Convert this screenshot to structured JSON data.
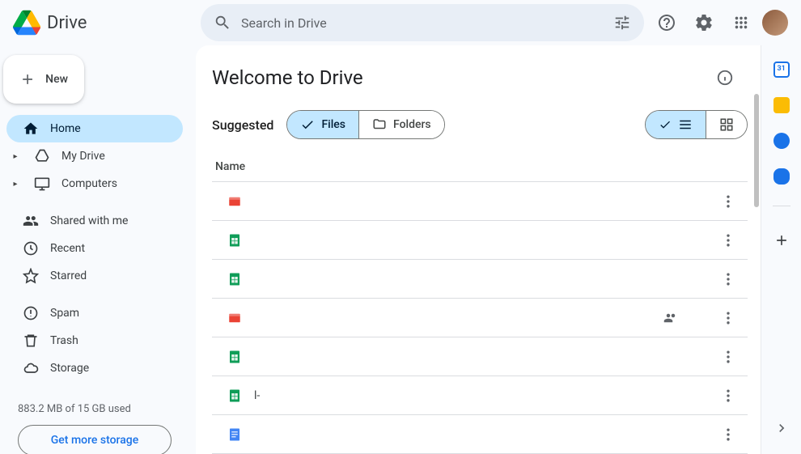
{
  "app_name": "Drive",
  "search": {
    "placeholder": "Search in Drive"
  },
  "new_button_label": "New",
  "nav": {
    "home": "Home",
    "my_drive": "My Drive",
    "computers": "Computers",
    "shared": "Shared with me",
    "recent": "Recent",
    "starred": "Starred",
    "spam": "Spam",
    "trash": "Trash",
    "storage": "Storage"
  },
  "storage_text": "883.2 MB of 15 GB used",
  "get_storage_label": "Get more storage",
  "main": {
    "title": "Welcome to Drive",
    "suggested": "Suggested",
    "files_label": "Files",
    "folders_label": "Folders",
    "column_name": "Name"
  },
  "files": [
    {
      "type": "video",
      "name": "",
      "shared": false
    },
    {
      "type": "sheet",
      "name": "",
      "shared": false
    },
    {
      "type": "sheet",
      "name": "",
      "shared": false
    },
    {
      "type": "video",
      "name": "",
      "shared": true
    },
    {
      "type": "sheet",
      "name": "",
      "shared": false
    },
    {
      "type": "sheet",
      "name": "l-",
      "shared": false
    },
    {
      "type": "doc",
      "name": "",
      "shared": false
    }
  ],
  "colors": {
    "active_bg": "#c2e7ff",
    "accent": "#1a73e8",
    "sheet": "#0f9d58",
    "doc": "#4285f4",
    "video": "#ea4335",
    "keep": "#fbbc04",
    "tasks": "#1a73e8",
    "contacts": "#1a73e8"
  }
}
